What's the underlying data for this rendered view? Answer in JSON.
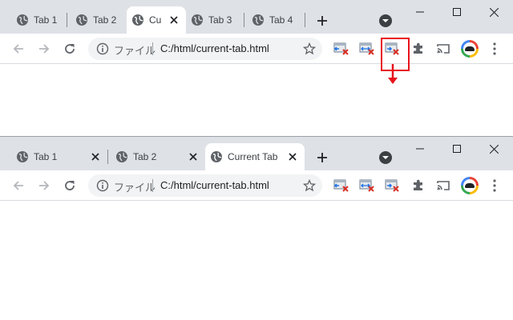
{
  "top_browser": {
    "tabs": [
      {
        "title": "Tab 1",
        "active": false
      },
      {
        "title": "Tab 2",
        "active": false
      },
      {
        "title": "Cu",
        "active": true
      },
      {
        "title": "Tab 3",
        "active": false
      },
      {
        "title": "Tab 4",
        "active": false
      }
    ],
    "address": {
      "scheme_label": "ファイル",
      "url": "C:/html/current-tab.html"
    },
    "highlighted_extension": "close-current-tab-extension"
  },
  "bottom_browser": {
    "tabs": [
      {
        "title": "Tab 1",
        "active": false
      },
      {
        "title": "Tab 2",
        "active": false
      },
      {
        "title": "Current Tab",
        "active": true
      }
    ],
    "address": {
      "scheme_label": "ファイル",
      "url": "C:/html/current-tab.html"
    }
  },
  "icons": {
    "tab": "globe-icon",
    "close": "close-icon",
    "new_tab": "plus-icon",
    "tab_search": "chevron-down-icon",
    "back": "back-arrow-icon",
    "forward": "forward-arrow-icon",
    "reload": "reload-icon",
    "info": "info-icon",
    "bookmark": "star-icon",
    "extensions": "puzzle-icon",
    "cast": "cast-icon",
    "menu": "kebab-menu-icon"
  },
  "colors": {
    "tabstrip": "#dee1e6",
    "highlight": "#e8131b",
    "icon": "#5f6368"
  }
}
